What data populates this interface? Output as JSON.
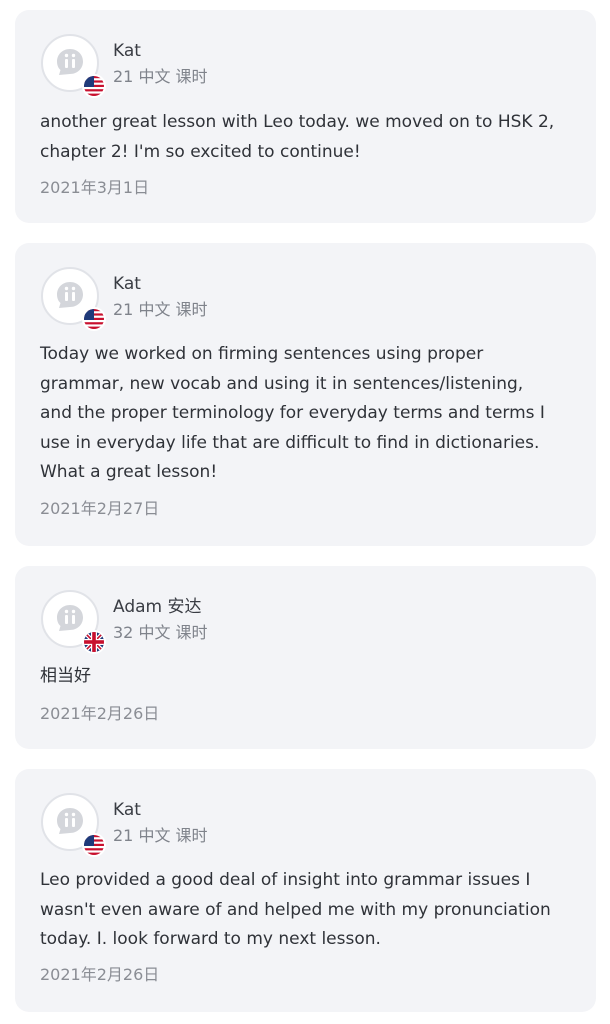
{
  "colors": {
    "card_background": "#f3f4f7",
    "name_text": "#3a3d44",
    "meta_text": "#7f838b",
    "review_text": "#2f3238",
    "date_text": "#8a8d94"
  },
  "reviews": [
    {
      "author": "Kat",
      "lessons": "21 中文 课时",
      "flag_icon": "us-flag-icon",
      "avatar_icon": "italki-logo-icon",
      "text_lines": [
        "another great lesson with Leo today. we moved on to HSK 2,",
        "chapter 2! I'm so excited to continue!"
      ],
      "date": "2021年3月1日"
    },
    {
      "author": "Kat",
      "lessons": "21 中文 课时",
      "flag_icon": "us-flag-icon",
      "avatar_icon": "italki-logo-icon",
      "text_lines": [
        "Today we worked on firming sentences using proper",
        "grammar, new vocab and using it in sentences/listening,",
        "and the proper terminology for everyday terms and terms I",
        "use in everyday life that are difficult to find in dictionaries.",
        "What a great lesson!"
      ],
      "date": "2021年2月27日"
    },
    {
      "author": "Adam 安达",
      "lessons": "32 中文 课时",
      "flag_icon": "uk-flag-icon",
      "avatar_icon": "italki-logo-icon",
      "text_lines": [
        "相当好"
      ],
      "date": "2021年2月26日"
    },
    {
      "author": "Kat",
      "lessons": "21 中文 课时",
      "flag_icon": "us-flag-icon",
      "avatar_icon": "italki-logo-icon",
      "text_lines": [
        "Leo provided a good deal of insight into grammar issues I",
        "wasn't even aware of and helped me with my pronunciation",
        "today. I. look forward to my next lesson."
      ],
      "date": "2021年2月26日"
    }
  ]
}
